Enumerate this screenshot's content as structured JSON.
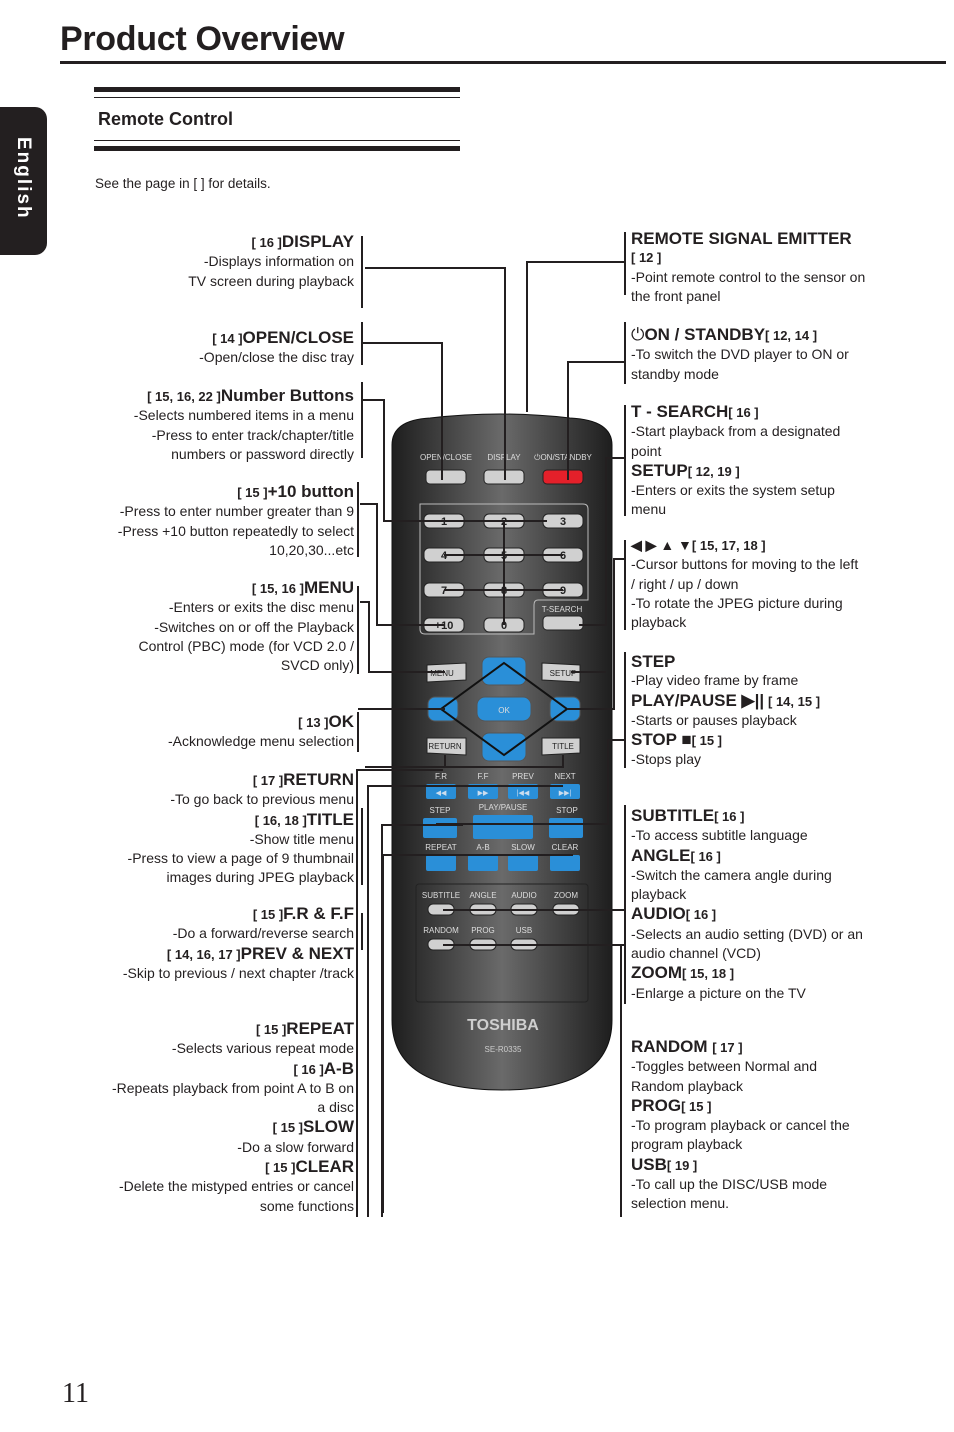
{
  "page": {
    "title": "Product Overview",
    "language_tab": "English",
    "section_title": "Remote Control",
    "see_page_note": "See the page in [   ] for details.",
    "page_number": "11"
  },
  "left_callouts": [
    {
      "id": "display",
      "ref": "[ 16 ]",
      "name": "DISPLAY",
      "desc": [
        "-Displays information on",
        "TV screen during playback"
      ]
    },
    {
      "id": "open-close",
      "ref": "[ 14 ]",
      "name": "OPEN/CLOSE",
      "desc": [
        "-Open/close the disc tray"
      ]
    },
    {
      "id": "number-buttons",
      "ref": "[ 15, 16, 22 ]",
      "name": "Number Buttons",
      "desc": [
        "-Selects numbered items in a menu",
        "-Press to enter track/chapter/title",
        "numbers or password directly"
      ]
    },
    {
      "id": "plus10",
      "ref": "[ 15 ]",
      "name": "+10 button",
      "desc": [
        "-Press to enter number greater than 9",
        "-Press +10 button repeatedly to select",
        "10,20,30...etc"
      ]
    },
    {
      "id": "menu",
      "ref": "[ 15, 16 ]",
      "name": "MENU",
      "desc": [
        "-Enters or exits the disc menu",
        "-Switches on or off the Playback",
        "Control (PBC) mode (for VCD 2.0 /",
        "SVCD only)"
      ]
    },
    {
      "id": "ok",
      "ref": "[ 13 ]",
      "name": "OK",
      "desc": [
        "-Acknowledge menu selection"
      ]
    },
    {
      "id": "return",
      "ref": "[ 17 ]",
      "name": "RETURN",
      "desc": [
        "-To go back to previous menu"
      ]
    },
    {
      "id": "title",
      "ref": "[ 16, 18 ]",
      "name": "TITLE",
      "desc": [
        "-Show title menu",
        "-Press to view a page of 9 thumbnail",
        "images during JPEG playback"
      ]
    },
    {
      "id": "fr-ff",
      "ref": "[ 15 ]",
      "name": "F.R & F.F",
      "desc": [
        "-Do a forward/reverse search"
      ]
    },
    {
      "id": "prev-next",
      "ref": "[ 14, 16, 17 ]",
      "name": "PREV & NEXT",
      "desc": [
        "-Skip to previous / next chapter /track"
      ]
    },
    {
      "id": "repeat",
      "ref": "[ 15 ]",
      "name": "REPEAT",
      "desc": [
        "-Selects various repeat mode"
      ]
    },
    {
      "id": "a-b",
      "ref": "[ 16 ]",
      "name": "A-B",
      "desc": [
        "-Repeats playback from point A to B on",
        "a disc"
      ]
    },
    {
      "id": "slow",
      "ref": "[ 15 ]",
      "name": "SLOW",
      "desc": [
        "-Do a slow forward"
      ]
    },
    {
      "id": "clear",
      "ref": "[ 15 ]",
      "name": "CLEAR",
      "desc": [
        "-Delete  the mistyped entries or cancel",
        "some functions"
      ]
    }
  ],
  "right_callouts": [
    {
      "id": "emitter",
      "name": "REMOTE SIGNAL EMITTER",
      "ref": "[ 12 ]",
      "desc": [
        "-Point remote control to the sensor on",
        "the front panel"
      ]
    },
    {
      "id": "on-standby",
      "icon": "⏻",
      "name": "ON / STANDBY",
      "ref": "[ 12, 14 ]",
      "desc": [
        "-To switch the DVD player to ON or",
        "standby mode"
      ]
    },
    {
      "id": "t-search",
      "name": "T - SEARCH",
      "ref": "[ 16 ]",
      "desc": [
        "-Start playback from a designated",
        "point"
      ]
    },
    {
      "id": "setup",
      "name": "SETUP",
      "ref": "[ 12, 19 ]",
      "desc": [
        "-Enters or exits the system setup",
        "menu"
      ]
    },
    {
      "id": "cursor",
      "name": "◀ ▶ ▲ ▼",
      "ref": "[ 15, 17, 18 ]",
      "desc": [
        "-Cursor buttons for moving to the left",
        "/ right / up / down",
        "-To rotate the JPEG picture during",
        "playback"
      ]
    },
    {
      "id": "step",
      "name": "STEP",
      "ref": "",
      "desc": [
        "-Play video frame by frame"
      ]
    },
    {
      "id": "play-pause",
      "name": "PLAY/PAUSE ▶||",
      "ref": "[ 14, 15 ]",
      "desc": [
        "-Starts or pauses playback"
      ]
    },
    {
      "id": "stop",
      "name": "STOP ■",
      "ref": "[ 15 ]",
      "desc": [
        "-Stops play"
      ]
    },
    {
      "id": "subtitle",
      "name": "SUBTITLE",
      "ref": "[ 16 ]",
      "desc": [
        "-To access subtitle language"
      ]
    },
    {
      "id": "angle",
      "name": "ANGLE",
      "ref": "[ 16 ]",
      "desc": [
        "-Switch the camera angle during",
        "playback"
      ]
    },
    {
      "id": "audio",
      "name": "AUDIO",
      "ref": "[ 16 ]",
      "desc": [
        "-Selects an audio setting (DVD) or an",
        "audio channel (VCD)"
      ]
    },
    {
      "id": "zoom",
      "name": "ZOOM",
      "ref": "[ 15, 18 ]",
      "desc": [
        "-Enlarge a picture on the TV"
      ]
    },
    {
      "id": "random",
      "name": "RANDOM ",
      "ref": "[ 17 ]",
      "desc": [
        "-Toggles between Normal and",
        "Random playback"
      ]
    },
    {
      "id": "prog",
      "name": "PROG",
      "ref": "[ 15 ]",
      "desc": [
        "-To program playback or cancel the",
        "program playback"
      ]
    },
    {
      "id": "usb",
      "name": "USB",
      "ref": "[ 19 ]",
      "desc": [
        "-To call up the DISC/USB mode",
        "selection menu."
      ]
    }
  ],
  "remote": {
    "brand": "TOSHIBA",
    "model": "SE-R0335",
    "top_labels": [
      "OPEN/CLOSE",
      "DISPLAY",
      "⏻ON/STANDBY"
    ],
    "number_keys": [
      "1",
      "2",
      "3",
      "4",
      "5",
      "6",
      "7",
      "8",
      "9",
      "+10",
      "0"
    ],
    "tsearch_label": "T-SEARCH",
    "menu_label": "MENU",
    "setup_label": "SETUP",
    "ok_label": "OK",
    "return_label": "RETURN",
    "title_label": "TITLE",
    "transport_labels": [
      "F.R",
      "F.F",
      "PREV",
      "NEXT"
    ],
    "transport_icons": [
      "◀◀",
      "▶▶",
      "|◀◀",
      "▶▶|"
    ],
    "step_label": "STEP",
    "playpause_label": "PLAY/PAUSE",
    "stop_label": "STOP",
    "repeat_labels": [
      "REPEAT",
      "A-B",
      "SLOW",
      "CLEAR"
    ],
    "func_labels_row1": [
      "SUBTITLE",
      "ANGLE",
      "AUDIO",
      "ZOOM"
    ],
    "func_labels_row2": [
      "RANDOM",
      "PROG",
      "USB"
    ],
    "colors": {
      "body": "#3a3a3a",
      "blue": "#2a8fd8",
      "red": "#e4202a",
      "grey": "#d0d0d0"
    }
  }
}
